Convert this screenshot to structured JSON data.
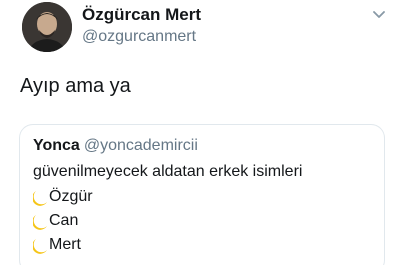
{
  "user": {
    "display_name": "Özgürcan Mert",
    "handle": "@ozgurcanmert"
  },
  "tweet": {
    "text": "Ayıp ama ya"
  },
  "quoted": {
    "display_name": "Yonca",
    "handle": "@yoncademircii",
    "text": "güvenilmeyecek aldatan erkek isimleri",
    "items": [
      {
        "icon": "crescent-moon-icon",
        "label": "Özgür"
      },
      {
        "icon": "crescent-moon-icon",
        "label": "Can"
      },
      {
        "icon": "crescent-moon-icon",
        "label": "Mert"
      }
    ]
  },
  "colors": {
    "name": "#14171a",
    "secondary": "#657786",
    "border": "#e1e8ed",
    "moon": "#f5c518"
  }
}
